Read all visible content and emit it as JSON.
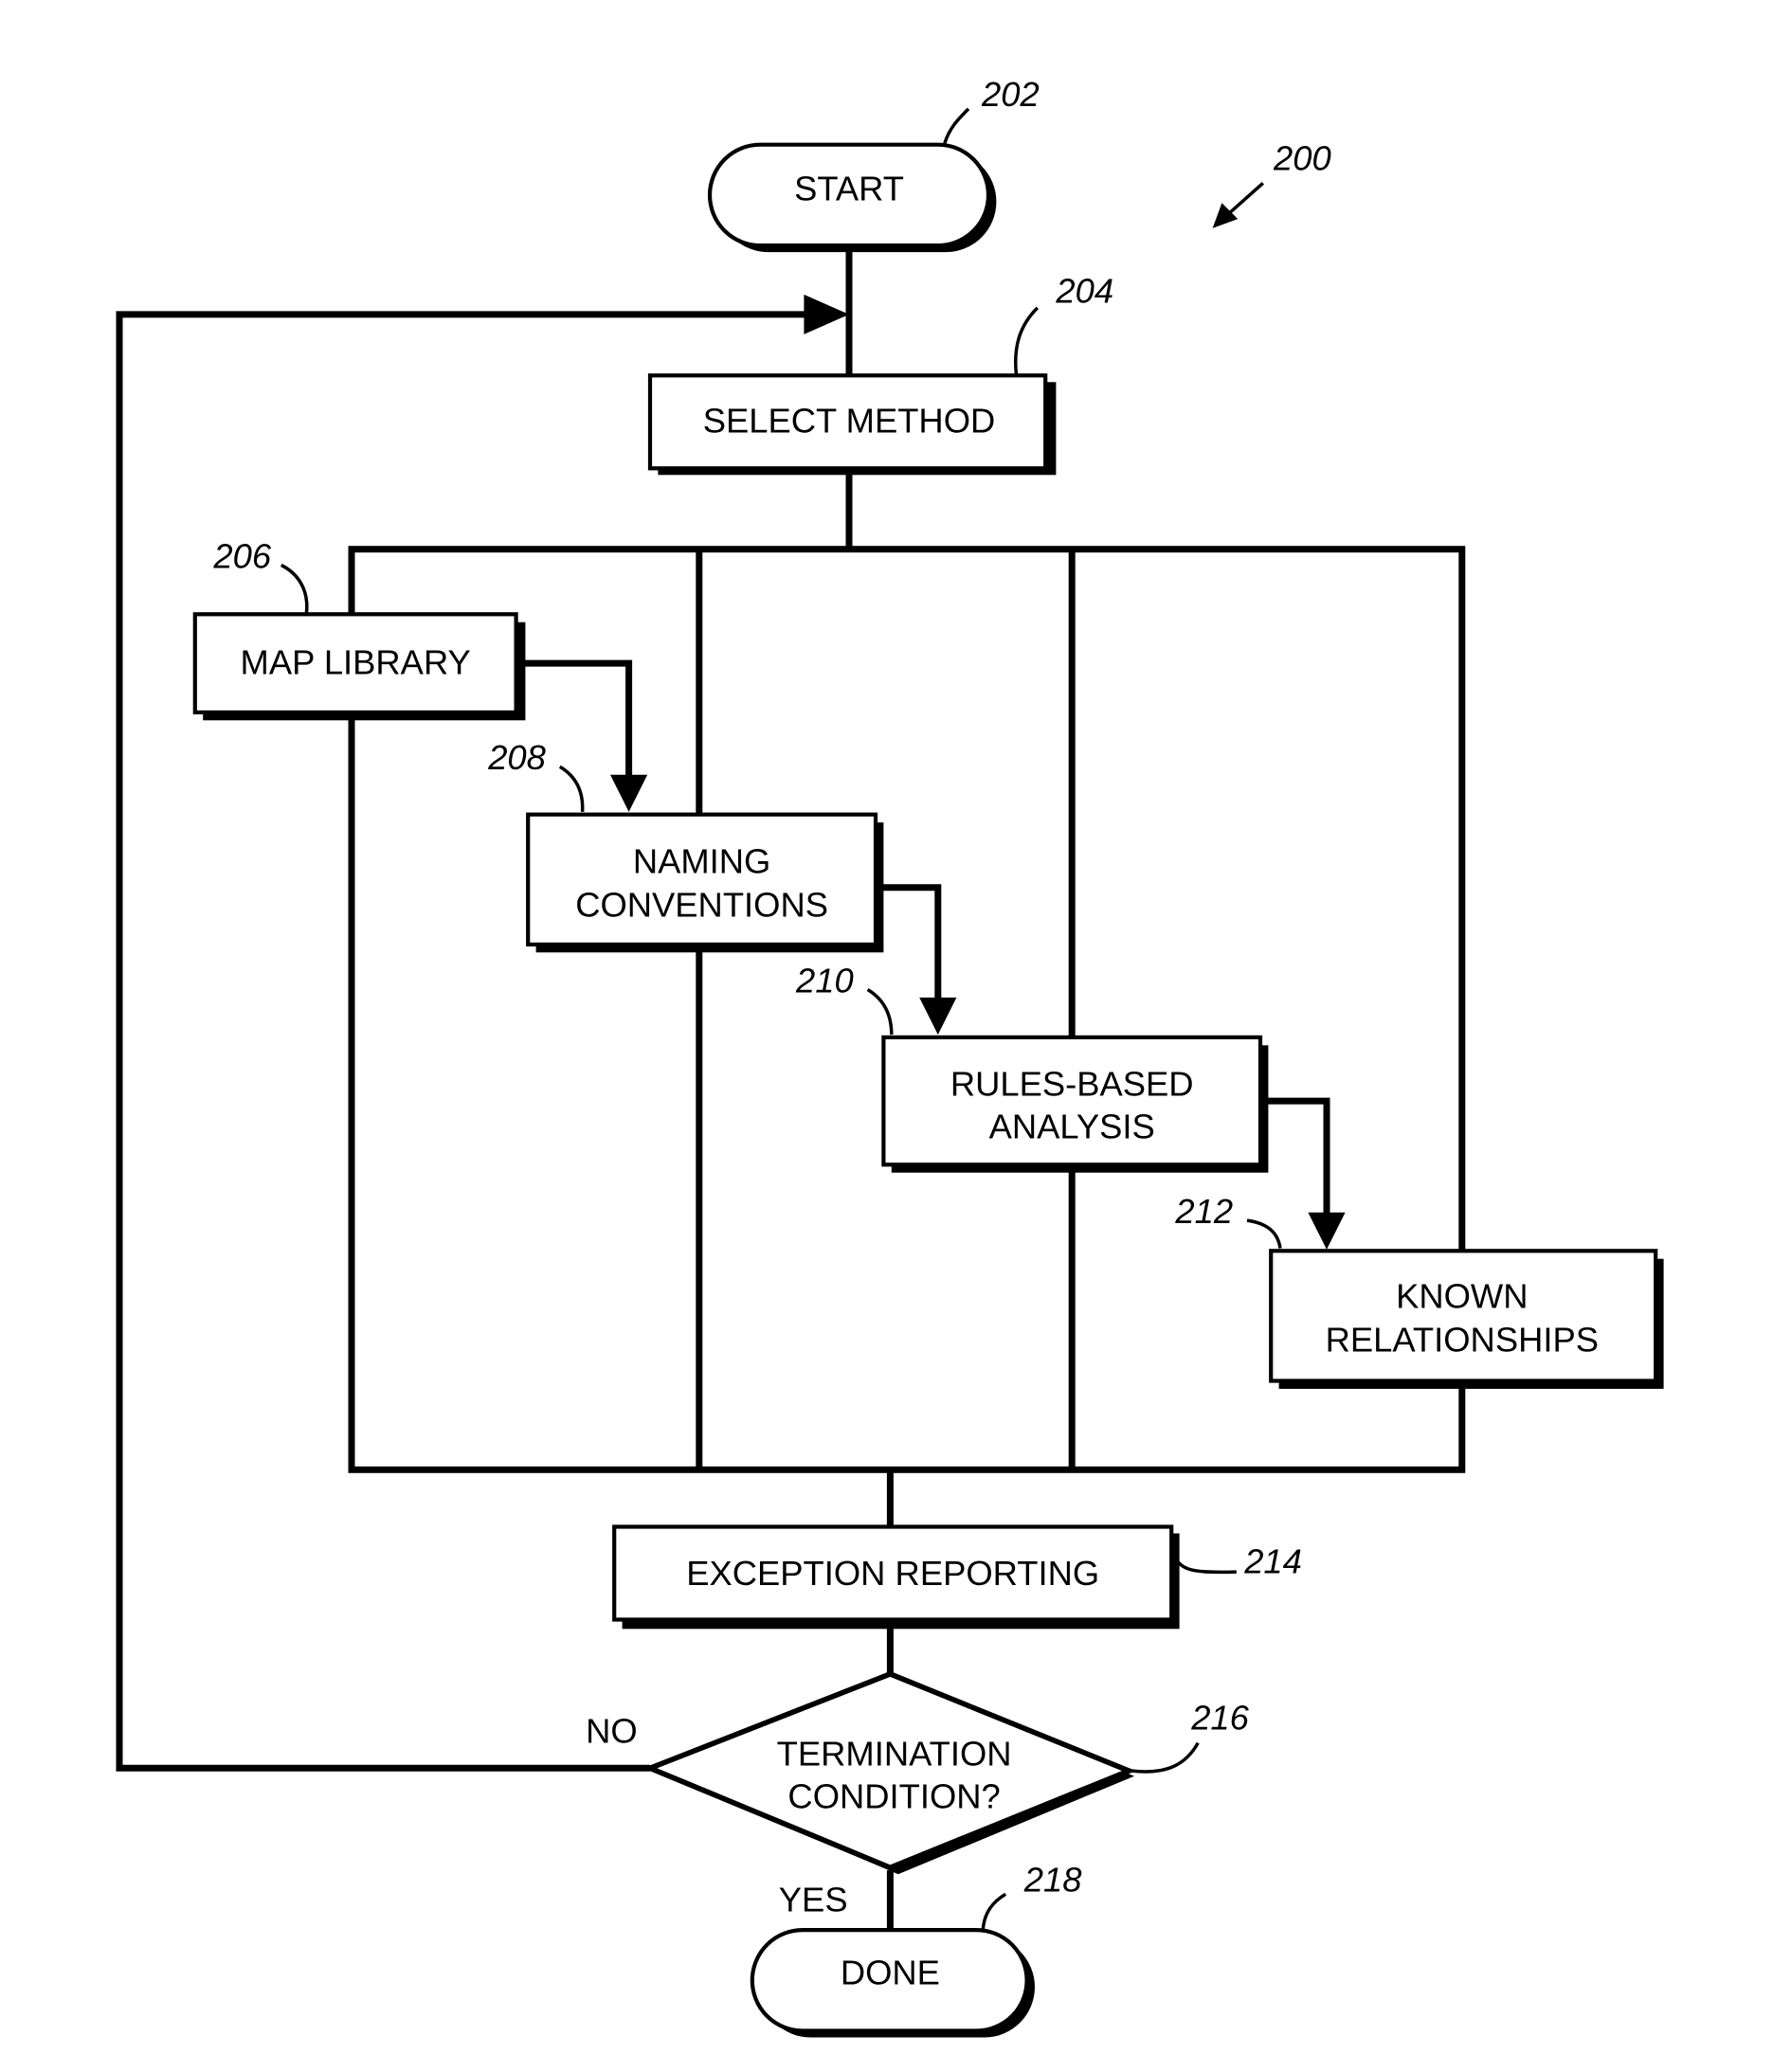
{
  "figure": {
    "ref": "200",
    "nodes": [
      {
        "id": "start",
        "ref": "202",
        "shape": "terminal",
        "lines": [
          "START"
        ]
      },
      {
        "id": "select_method",
        "ref": "204",
        "shape": "process",
        "lines": [
          "SELECT METHOD"
        ]
      },
      {
        "id": "map_library",
        "ref": "206",
        "shape": "process",
        "lines": [
          "MAP LIBRARY"
        ]
      },
      {
        "id": "naming_conventions",
        "ref": "208",
        "shape": "process",
        "lines": [
          "NAMING",
          "CONVENTIONS"
        ]
      },
      {
        "id": "rules_based_analysis",
        "ref": "210",
        "shape": "process",
        "lines": [
          "RULES-BASED",
          "ANALYSIS"
        ]
      },
      {
        "id": "known_relationships",
        "ref": "212",
        "shape": "process",
        "lines": [
          "KNOWN",
          "RELATIONSHIPS"
        ]
      },
      {
        "id": "exception_reporting",
        "ref": "214",
        "shape": "process",
        "lines": [
          "EXCEPTION REPORTING"
        ]
      },
      {
        "id": "termination_condition",
        "ref": "216",
        "shape": "decision",
        "lines": [
          "TERMINATION",
          "CONDITION?"
        ]
      },
      {
        "id": "done",
        "ref": "218",
        "shape": "terminal",
        "lines": [
          "DONE"
        ]
      }
    ],
    "edges": [
      {
        "from": "start",
        "to": "select_method"
      },
      {
        "from": "select_method",
        "to": "method_block"
      },
      {
        "from": "map_library",
        "to": "naming_conventions"
      },
      {
        "from": "naming_conventions",
        "to": "rules_based_analysis"
      },
      {
        "from": "rules_based_analysis",
        "to": "known_relationships"
      },
      {
        "from": "method_block",
        "to": "exception_reporting"
      },
      {
        "from": "exception_reporting",
        "to": "termination_condition"
      },
      {
        "from": "termination_condition",
        "to": "select_method",
        "label": "NO"
      },
      {
        "from": "termination_condition",
        "to": "done",
        "label": "YES"
      }
    ],
    "branch_labels": {
      "no": "NO",
      "yes": "YES"
    }
  }
}
